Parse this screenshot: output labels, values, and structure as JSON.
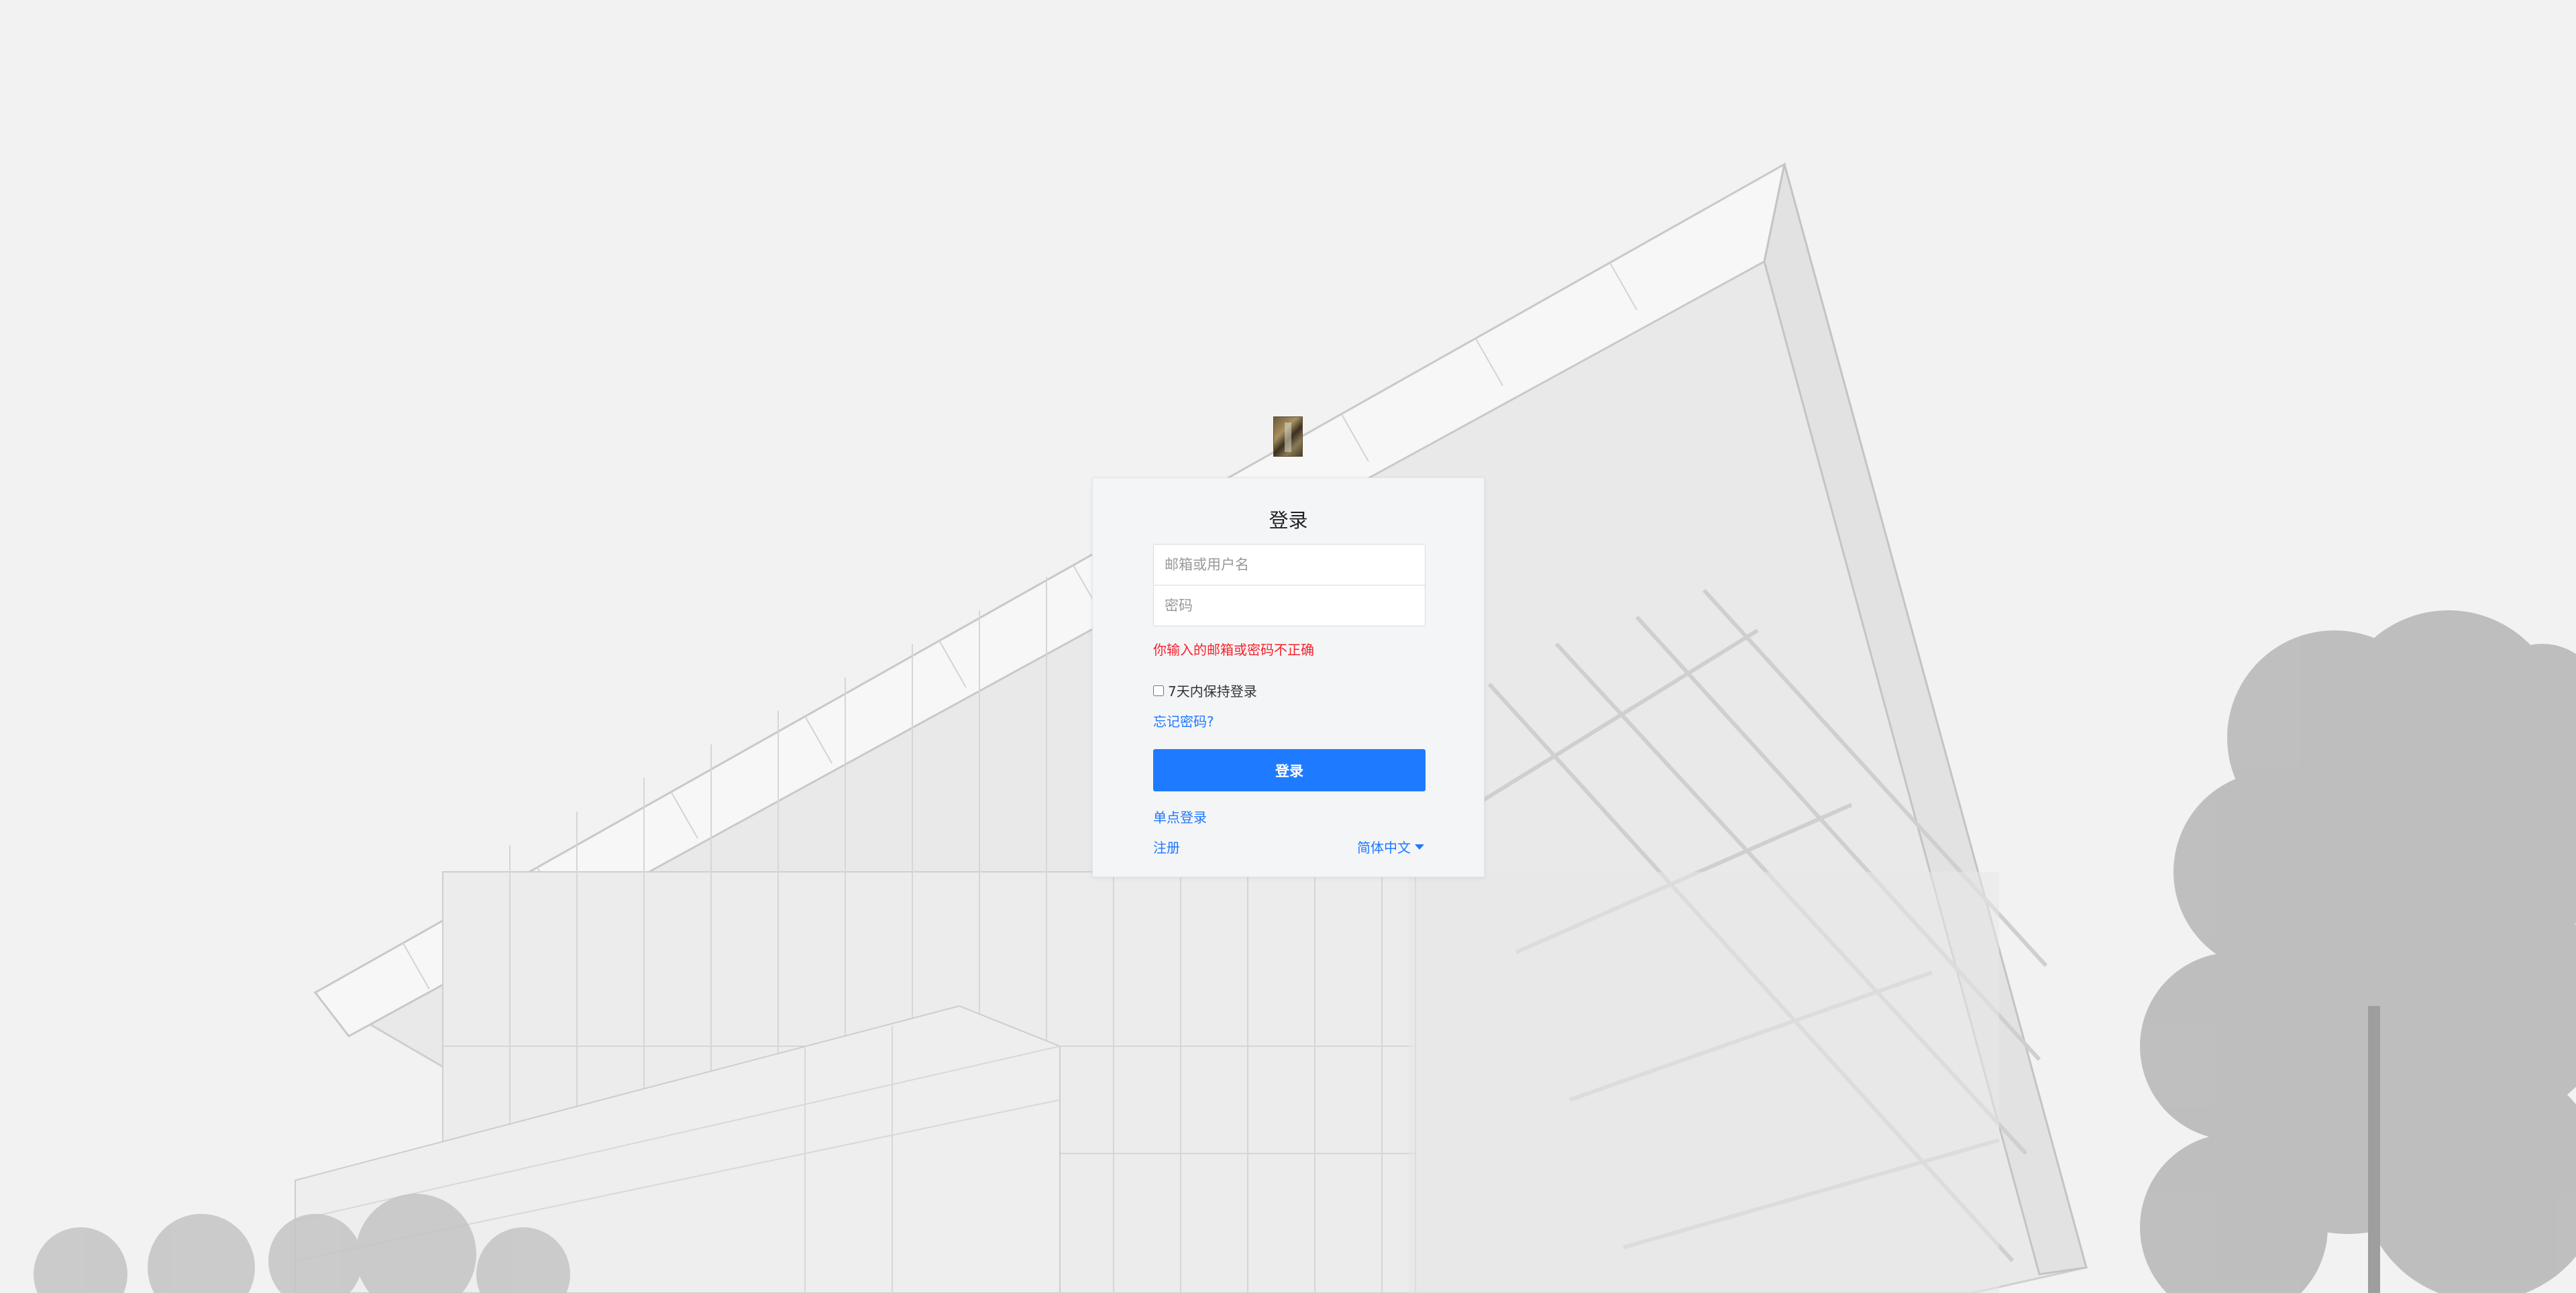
{
  "login": {
    "title": "登录",
    "username_placeholder": "邮箱或用户名",
    "password_placeholder": "密码",
    "error_message": "你输入的邮箱或密码不正确",
    "remember_label": "7天内保持登录",
    "remember_checked": false,
    "forgot_password": "忘记密码?",
    "submit_label": "登录",
    "sso_label": "单点登录",
    "register_label": "注册",
    "language_label": "简体中文"
  },
  "colors": {
    "accent": "#1e7bff",
    "error": "#f5222d",
    "background": "#f2f2f2"
  },
  "icons": {
    "logo": "logo-image",
    "language_dropdown": "caret-down-icon"
  }
}
